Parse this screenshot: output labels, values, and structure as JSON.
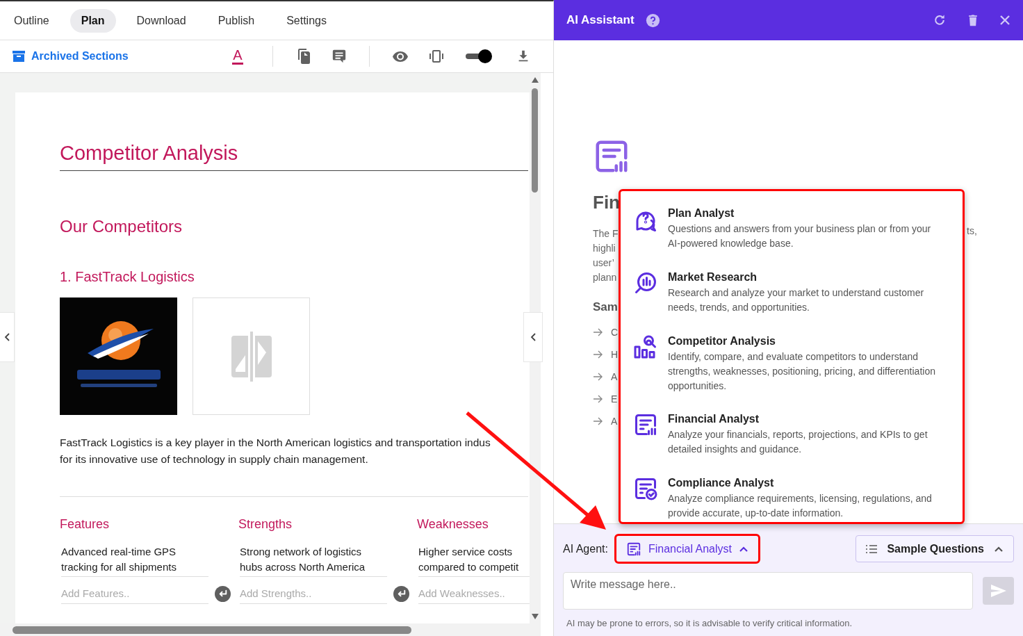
{
  "editor": {
    "tabs": [
      {
        "label": "Outline",
        "selected": false
      },
      {
        "label": "Plan",
        "selected": true
      },
      {
        "label": "Download",
        "selected": false
      },
      {
        "label": "Publish",
        "selected": false
      },
      {
        "label": "Settings",
        "selected": false
      }
    ],
    "toolbar": {
      "archived_link": "Archived Sections",
      "font_color_glyph": "A",
      "preview_toggle": {
        "on": true
      }
    },
    "document": {
      "title": "Competitor Analysis",
      "section": "Our Competitors",
      "competitor": "1. FastTrack Logistics",
      "logo": {
        "kind": "picture"
      },
      "description_lines": [
        "FastTrack Logistics is a key player in the North American logistics and transportation indus",
        "for its innovative use of technology in supply chain management."
      ],
      "columns": [
        {
          "heading": "Features",
          "item_lines": [
            "Advanced real-time GPS",
            "tracking for all shipments"
          ],
          "placeholder": "Add Features.."
        },
        {
          "heading": "Strengths",
          "item_lines": [
            "Strong network of logistics",
            "hubs across North America"
          ],
          "placeholder": "Add Strengths.."
        },
        {
          "heading": "Weaknesses",
          "item_lines": [
            "Higher service costs",
            "compared to competit"
          ],
          "placeholder": "Add Weaknesses.."
        }
      ]
    }
  },
  "assistant": {
    "title": "AI Assistant",
    "background": {
      "title": "Fin",
      "description_fragments": [
        "The F",
        "highli",
        "user’",
        "plann"
      ],
      "description_end": "ts,",
      "samples_heading": "Sam",
      "sample_fragments": [
        "C",
        "H",
        "A",
        "E",
        "A"
      ]
    },
    "agent_menu": {
      "open": true,
      "highlighted": true,
      "items": [
        {
          "kind": "plan",
          "title": "Plan Analyst",
          "description": "Questions and answers from your business plan or from your AI-powered knowledge base."
        },
        {
          "kind": "market",
          "title": "Market Research",
          "description": "Research and analyze your market to understand customer needs, trends, and opportunities."
        },
        {
          "kind": "competitor",
          "title": "Competitor Analysis",
          "description": "Identify, compare, and evaluate competitors to understand strengths, weaknesses, positioning, pricing, and differentiation opportunities."
        },
        {
          "kind": "financial",
          "title": "Financial Analyst",
          "description": "Analyze your financials, reports, projections, and KPIs to get detailed insights and guidance."
        },
        {
          "kind": "compliance",
          "title": "Compliance Analyst",
          "description": "Analyze compliance requirements, licensing, regulations, and provide accurate, up-to-date information."
        }
      ]
    },
    "agent_label": "AI Agent:",
    "agent": {
      "kind": "financial",
      "label": "Financial Analyst",
      "expanded": true,
      "highlighted": true
    },
    "sample_questions": {
      "label": "Sample Questions",
      "expanded": true
    },
    "message": {
      "placeholder": "Write message here.."
    },
    "send": {
      "disabled": true
    },
    "disclaimer": "AI may be prone to errors, so it is advisable to verify critical information."
  }
}
